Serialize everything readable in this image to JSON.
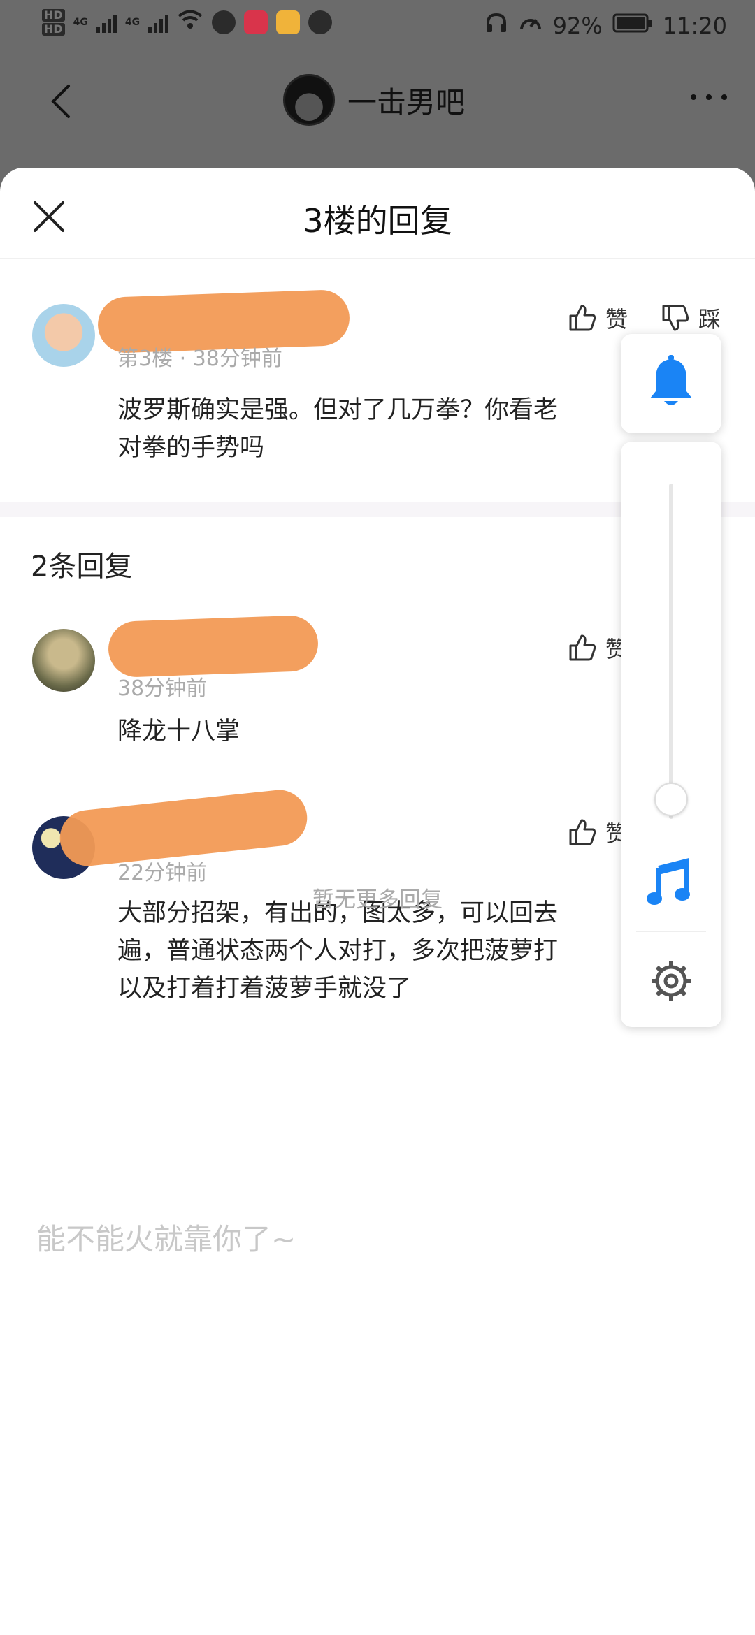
{
  "status": {
    "battery": "92%",
    "time": "11:20",
    "net": "4G"
  },
  "header": {
    "forum_name": "一击男吧"
  },
  "sheet": {
    "title": "3楼的回复"
  },
  "main_comment": {
    "floor_time": "第3楼 · 38分钟前",
    "text_line1": "波罗斯确实是强。但对了几万拳？你看老",
    "text_line2": "对拳的手势吗",
    "like_label": "赞",
    "dislike_label": "踩"
  },
  "reply_count": "2条回复",
  "replies": [
    {
      "time": "38分钟前",
      "text": "降龙十八掌",
      "like_label": "赞"
    },
    {
      "time": "22分钟前",
      "line1": "大部分招架，有出的，图太多，可以回去",
      "line2": "遍，普通状态两个人对打，多次把菠萝打",
      "line3": "以及打着打着菠萝手就没了",
      "like_label": "赞"
    }
  ],
  "end_text": "暂无更多回复",
  "input": {
    "placeholder": "能不能火就靠你了~"
  },
  "colors": {
    "accent": "#1a84f5",
    "scribble": "#f29a55"
  }
}
